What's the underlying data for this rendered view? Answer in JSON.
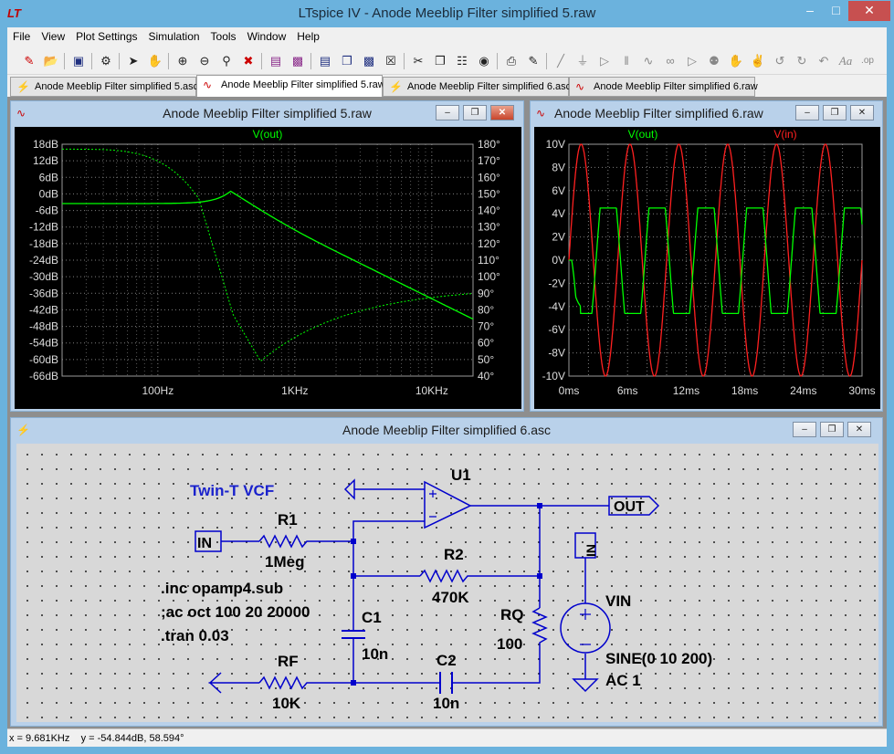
{
  "window": {
    "title": "LTspice IV - Anode Meeblip Filter simplified 5.raw",
    "logo": "LT"
  },
  "menu": [
    "File",
    "View",
    "Plot Settings",
    "Simulation",
    "Tools",
    "Window",
    "Help"
  ],
  "tabs": [
    {
      "label": "Anode Meeblip Filter simplified 5.asc",
      "icon": "schematic-icon",
      "active": false
    },
    {
      "label": "Anode Meeblip Filter simplified 5.raw",
      "icon": "waveform-icon",
      "active": true
    },
    {
      "label": "Anode Meeblip Filter simplified 6.asc",
      "icon": "schematic-icon",
      "active": false
    },
    {
      "label": "Anode Meeblip Filter simplified 6.raw",
      "icon": "waveform-icon",
      "active": false
    }
  ],
  "plot5": {
    "title": "Anode Meeblip Filter simplified 5.raw",
    "trace_label": "V(out)",
    "y_ticks": [
      "18dB",
      "12dB",
      "6dB",
      "0dB",
      "-6dB",
      "-12dB",
      "-18dB",
      "-24dB",
      "-30dB",
      "-36dB",
      "-42dB",
      "-48dB",
      "-54dB",
      "-60dB",
      "-66dB"
    ],
    "y2_ticks": [
      "180°",
      "170°",
      "160°",
      "150°",
      "140°",
      "130°",
      "120°",
      "110°",
      "100°",
      "90°",
      "80°",
      "70°",
      "60°",
      "50°",
      "40°"
    ],
    "x_ticks": [
      "100Hz",
      "1KHz",
      "10KHz"
    ]
  },
  "plot6": {
    "title": "Anode Meeblip Filter simplified 6.raw",
    "trace1_label": "V(out)",
    "trace2_label": "V(in)",
    "y_ticks": [
      "10V",
      "8V",
      "6V",
      "4V",
      "2V",
      "0V",
      "-2V",
      "-4V",
      "-6V",
      "-8V",
      "-10V"
    ],
    "x_ticks": [
      "0ms",
      "6ms",
      "12ms",
      "18ms",
      "24ms",
      "30ms"
    ]
  },
  "schematic": {
    "title": "Anode Meeblip Filter simplified 6.asc",
    "heading": "Twin-T VCF",
    "u1": "U1",
    "out_label": "OUT",
    "in_label": "IN",
    "vin_label": "VIN",
    "r1": {
      "name": "R1",
      "value": "1Meg"
    },
    "r2": {
      "name": "R2",
      "value": "470K"
    },
    "rq": {
      "name": "RQ",
      "value": "100"
    },
    "rf": {
      "name": "RF",
      "value": "10K"
    },
    "c1": {
      "name": "C1",
      "value": "10n"
    },
    "c2": {
      "name": "C2",
      "value": "10n"
    },
    "directives": [
      ".inc opamp4.sub",
      ";ac oct 100 20 20000",
      ".tran 0.03"
    ],
    "source_lines": [
      "SINE(0 10 200)",
      "AC 1"
    ]
  },
  "status": {
    "x": "x = 9.681KHz",
    "y": "y = -54.844dB, 58.594°"
  },
  "colors": {
    "trace_green": "#00ff00",
    "trace_red": "#ff2020",
    "wire_blue": "#0000cc",
    "grid": "#7f7f7f"
  }
}
